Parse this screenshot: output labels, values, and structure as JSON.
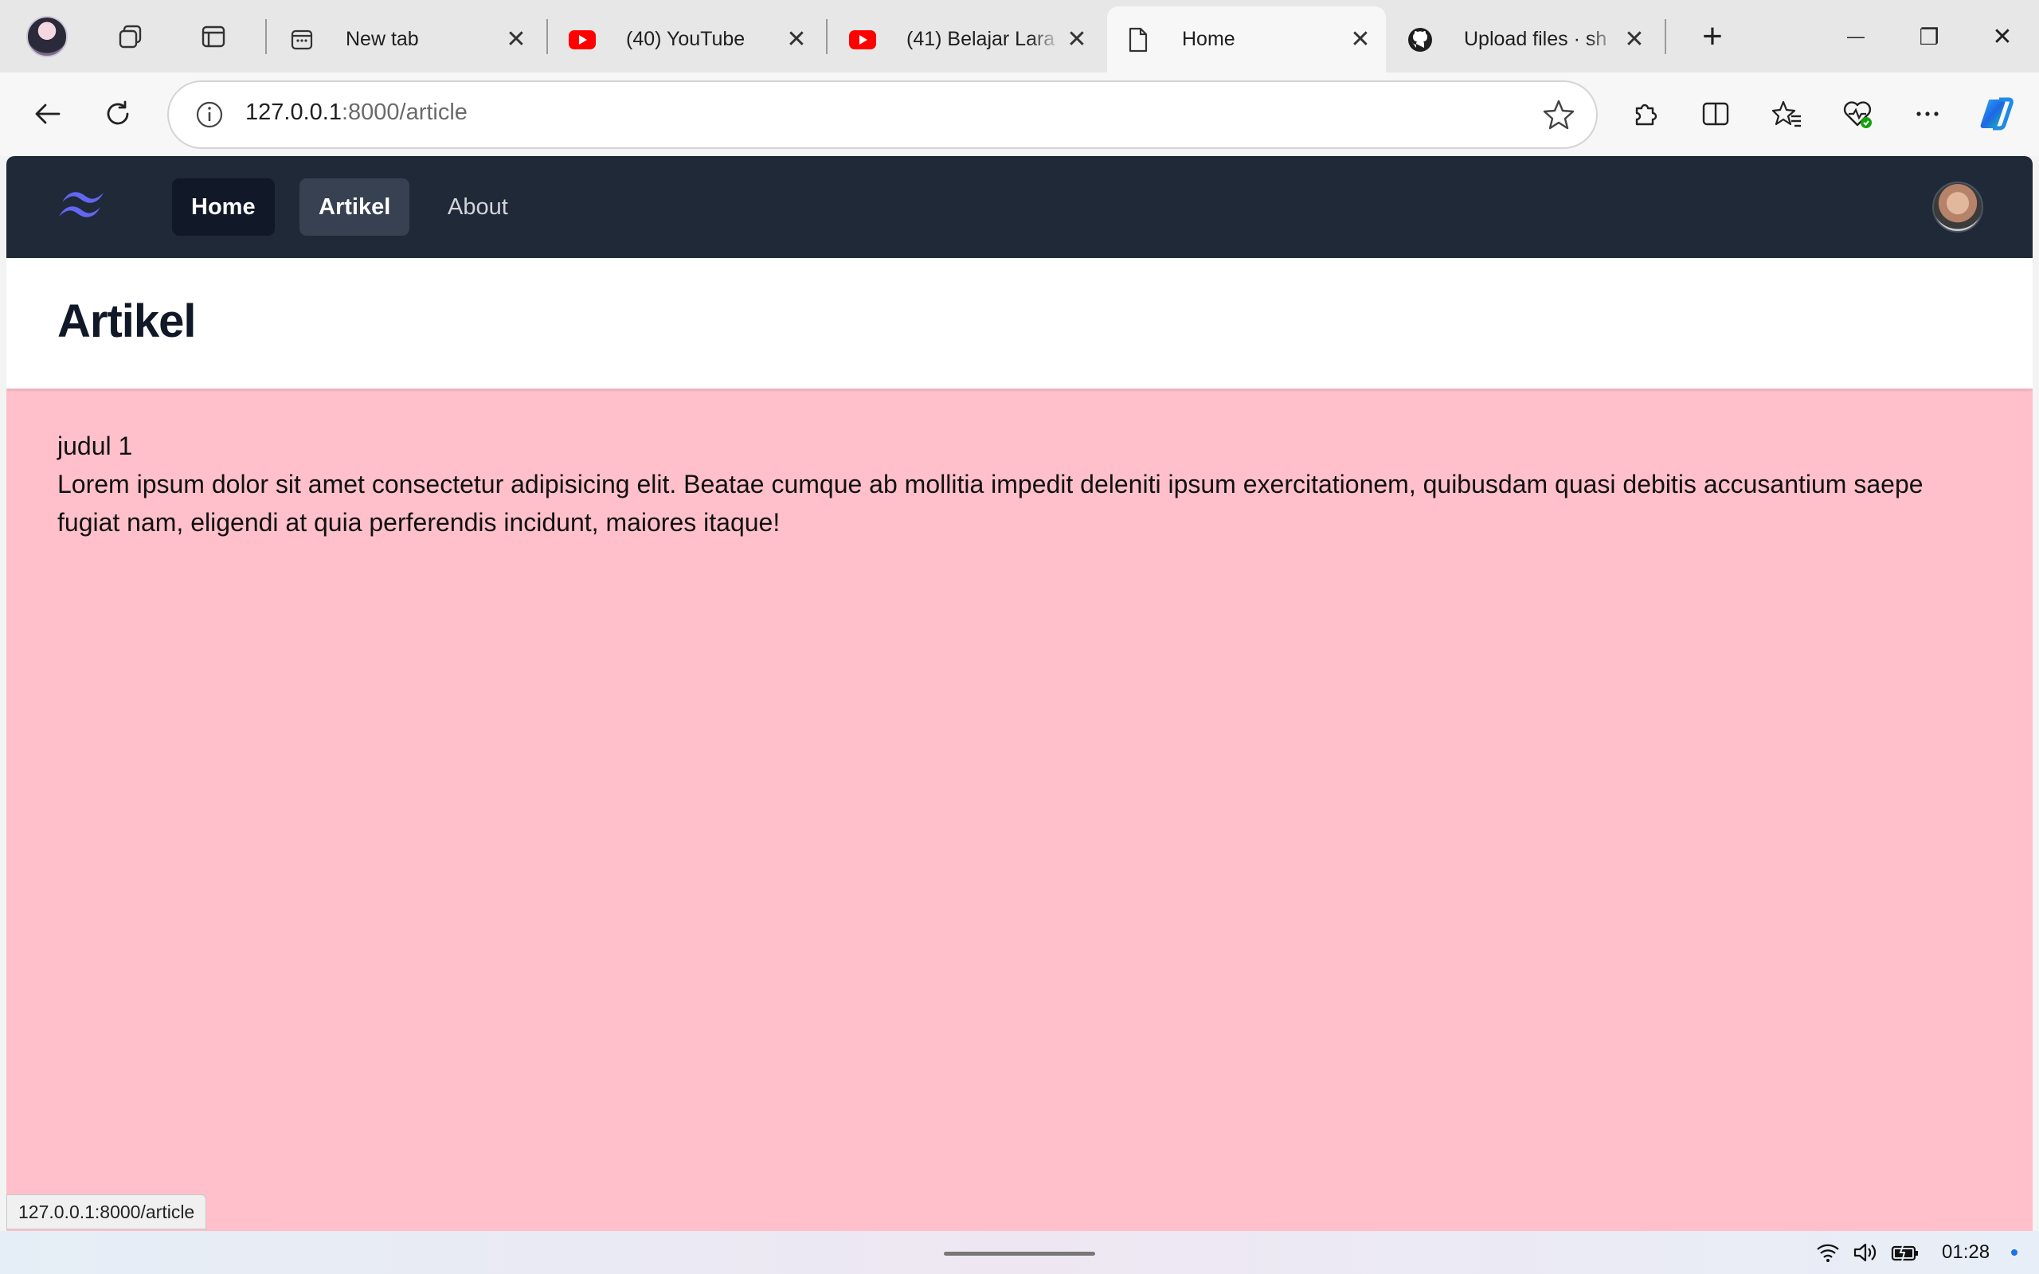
{
  "browser": {
    "tabs": [
      {
        "title": "New tab",
        "favicon": "new-tab-icon"
      },
      {
        "title": "(40) YouTube",
        "favicon": "youtube-icon"
      },
      {
        "title": "(41) Belajar Lara",
        "favicon": "youtube-icon"
      },
      {
        "title": "Home",
        "favicon": "page-icon",
        "active": true
      },
      {
        "title": "Upload files · sh",
        "favicon": "github-icon"
      }
    ],
    "close_glyph": "✕",
    "new_tab_glyph": "+",
    "window": {
      "minimize": "—",
      "restore": "❐",
      "close": "✕"
    },
    "address": {
      "host": "127.0.0.1",
      "path": ":8000/article"
    }
  },
  "site": {
    "nav": {
      "items": [
        {
          "label": "Home",
          "state": "current"
        },
        {
          "label": "Artikel",
          "state": "hover"
        },
        {
          "label": "About",
          "state": "plain"
        }
      ]
    },
    "header": {
      "title": "Artikel"
    },
    "article": {
      "title": "judul 1",
      "body": "Lorem ipsum dolor sit amet consectetur adipisicing elit. Beatae cumque ab mollitia impedit deleniti ipsum exercitationem, quibusdam quasi debitis accusantium saepe fugiat nam, eligendi at quia perferendis incidunt, maiores itaque!"
    },
    "colors": {
      "nav_bg": "#1f2937",
      "page_bg": "#ffc0cb",
      "logo": "#6366f1"
    }
  },
  "status_bar": {
    "url": "127.0.0.1:8000/article"
  },
  "taskbar": {
    "time": "01:28"
  }
}
